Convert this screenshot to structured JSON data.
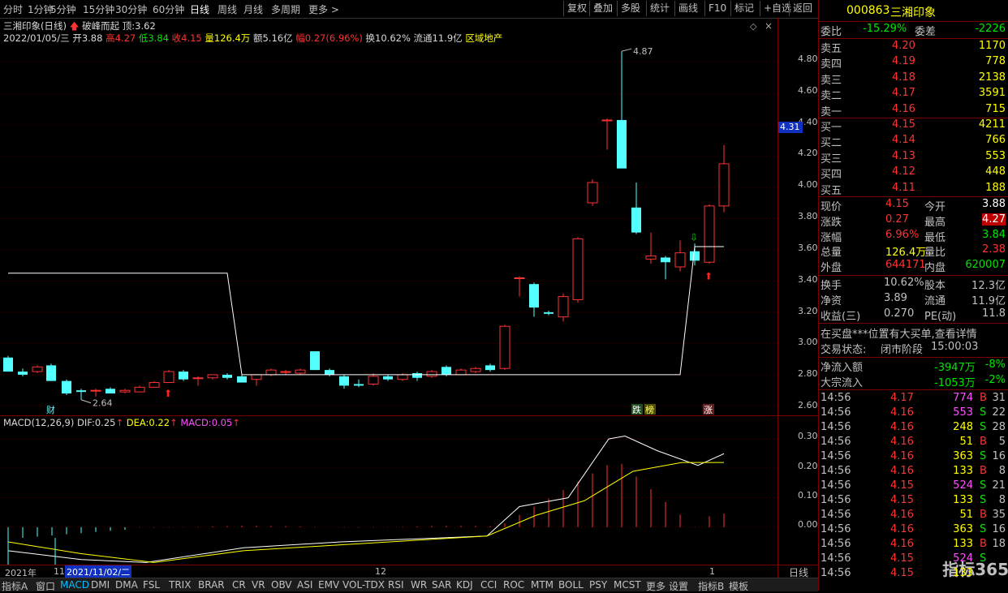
{
  "toolbar": {
    "periods": [
      "分时",
      "1分钟",
      "5分钟",
      "15分钟",
      "30分钟",
      "60分钟",
      "日线",
      "周线",
      "月线",
      "多周期",
      "更多 >"
    ],
    "active_period": "日线",
    "buttons": [
      "复权",
      "叠加",
      "多股",
      "统计",
      "画线",
      "F10",
      "标记",
      "+自选",
      "返回"
    ]
  },
  "chart_header": {
    "name": "三湘印象",
    "period": "(日线)",
    "indicator_name": "破峰而起",
    "top_label": "顶:",
    "top_value": "3.62"
  },
  "info": {
    "date": "2022/01/05/三",
    "open_label": "开",
    "open": "3.88",
    "high_label": "高",
    "high": "4.27",
    "low_label": "低",
    "low": "3.84",
    "close_label": "收",
    "close": "4.15",
    "vol_label": "量",
    "vol": "126.4万",
    "amount_label": "额",
    "amount": "5.16亿",
    "range_label": "幅",
    "range": "0.27(6.96%)",
    "turnover_label": "换",
    "turnover": "10.62%",
    "float_label": "流通",
    "float": "11.9亿",
    "sector": "区域地产"
  },
  "y_axis": [
    "4.80",
    "4.60",
    "4.40",
    "4.20",
    "4.00",
    "3.80",
    "3.60",
    "3.40",
    "3.20",
    "3.00",
    "2.80",
    "2.60"
  ],
  "current_price_tag": "4.31",
  "annotations": {
    "high": "4.87",
    "low": "2.64",
    "cai": "财",
    "die": "跌",
    "bang": "榜",
    "zhang": "涨"
  },
  "macd": {
    "label": "MACD(12,26,9)",
    "dif_label": "DIF:",
    "dif": "0.25",
    "dea_label": "DEA:",
    "dea": "0.22",
    "macd_label": "MACD:",
    "macd": "0.05",
    "y_axis": [
      "0.30",
      "0.20",
      "0.10",
      "0.00"
    ]
  },
  "date_axis": {
    "year": "2021年",
    "m11": "11",
    "cursor_date": "2021/11/02/二",
    "m12": "12",
    "m1": "1",
    "period_button": "日线"
  },
  "bottom_tabs": [
    "指标A",
    "窗口",
    "MACD",
    "DMI",
    "DMA",
    "FSL",
    "TRIX",
    "BRAR",
    "CR",
    "VR",
    "OBV",
    "ASI",
    "EMV",
    "VOL-TDX",
    "RSI",
    "WR",
    "SAR",
    "KDJ",
    "CCI",
    "ROC",
    "MTM",
    "BOLL",
    "PSY",
    "MCST",
    "更多",
    "设置",
    "指标B",
    "模板"
  ],
  "active_bottom_tab": "MACD",
  "stock": {
    "code": "000863",
    "name": "三湘印象",
    "weibi_label": "委比",
    "weibi": "-15.29%",
    "weicha_label": "委差",
    "weicha": "-2226",
    "asks": [
      {
        "label": "卖五",
        "price": "4.20",
        "vol": "1170"
      },
      {
        "label": "卖四",
        "price": "4.19",
        "vol": "778"
      },
      {
        "label": "卖三",
        "price": "4.18",
        "vol": "2138"
      },
      {
        "label": "卖二",
        "price": "4.17",
        "vol": "3591"
      },
      {
        "label": "卖一",
        "price": "4.16",
        "vol": "715"
      }
    ],
    "bids": [
      {
        "label": "买一",
        "price": "4.15",
        "vol": "4211"
      },
      {
        "label": "买二",
        "price": "4.14",
        "vol": "766"
      },
      {
        "label": "买三",
        "price": "4.13",
        "vol": "553"
      },
      {
        "label": "买四",
        "price": "4.12",
        "vol": "448"
      },
      {
        "label": "买五",
        "price": "4.11",
        "vol": "188"
      }
    ],
    "quote": [
      {
        "l1": "现价",
        "v1": "4.15",
        "l2": "今开",
        "v2": "3.88"
      },
      {
        "l1": "涨跌",
        "v1": "0.27",
        "l2": "最高",
        "v2": "4.27"
      },
      {
        "l1": "涨幅",
        "v1": "6.96%",
        "l2": "最低",
        "v2": "3.84"
      },
      {
        "l1": "总量",
        "v1": "126.4万",
        "l2": "量比",
        "v2": "2.38"
      },
      {
        "l1": "外盘",
        "v1": "644171",
        "l2": "内盘",
        "v2": "620007"
      }
    ],
    "fund": [
      {
        "l1": "换手",
        "v1": "10.62%",
        "l2": "股本",
        "v2": "12.3亿"
      },
      {
        "l1": "净资",
        "v1": "3.89",
        "l2": "流通",
        "v2": "11.9亿"
      },
      {
        "l1": "收益(三)",
        "v1": "0.270",
        "l2": "PE(动)",
        "v2": "11.8"
      }
    ],
    "notice": "在买盘***位置有大买单,查看详情",
    "trade_status_label": "交易状态:",
    "trade_status": "闭市阶段",
    "trade_time": "15:00:03",
    "flows": [
      {
        "label": "净流入额",
        "value": "-3947万",
        "pct": "-8%"
      },
      {
        "label": "大宗流入",
        "value": "-1053万",
        "pct": "-2%"
      }
    ],
    "ticks": [
      {
        "t": "14:56",
        "p": "4.17",
        "v": "774",
        "bs": "B",
        "n": "31",
        "c": "m"
      },
      {
        "t": "14:56",
        "p": "4.16",
        "v": "553",
        "bs": "S",
        "n": "22",
        "c": "m"
      },
      {
        "t": "14:56",
        "p": "4.16",
        "v": "248",
        "bs": "S",
        "n": "28",
        "c": "y"
      },
      {
        "t": "14:56",
        "p": "4.16",
        "v": "51",
        "bs": "B",
        "n": "5",
        "c": "y"
      },
      {
        "t": "14:56",
        "p": "4.16",
        "v": "363",
        "bs": "S",
        "n": "16",
        "c": "y"
      },
      {
        "t": "14:56",
        "p": "4.16",
        "v": "133",
        "bs": "B",
        "n": "8",
        "c": "y"
      },
      {
        "t": "14:56",
        "p": "4.15",
        "v": "524",
        "bs": "S",
        "n": "21",
        "c": "m"
      },
      {
        "t": "14:56",
        "p": "4.15",
        "v": "133",
        "bs": "S",
        "n": "8",
        "c": "y"
      },
      {
        "t": "14:56",
        "p": "4.16",
        "v": "51",
        "bs": "B",
        "n": "35",
        "c": "y"
      },
      {
        "t": "14:56",
        "p": "4.16",
        "v": "363",
        "bs": "S",
        "n": "16",
        "c": "y"
      },
      {
        "t": "14:56",
        "p": "4.16",
        "v": "133",
        "bs": "B",
        "n": "18",
        "c": "y"
      },
      {
        "t": "14:56",
        "p": "4.15",
        "v": "524",
        "bs": "S",
        "n": "",
        "c": "m"
      },
      {
        "t": "14:56",
        "p": "4.15",
        "v": "133",
        "bs": "",
        "n": "",
        "c": "y"
      }
    ]
  },
  "watermark": "指标365",
  "colors": {
    "up": "#ff3232",
    "down": "#54ffff",
    "axis": "#7a0000",
    "text": "#c0c0c0"
  }
}
